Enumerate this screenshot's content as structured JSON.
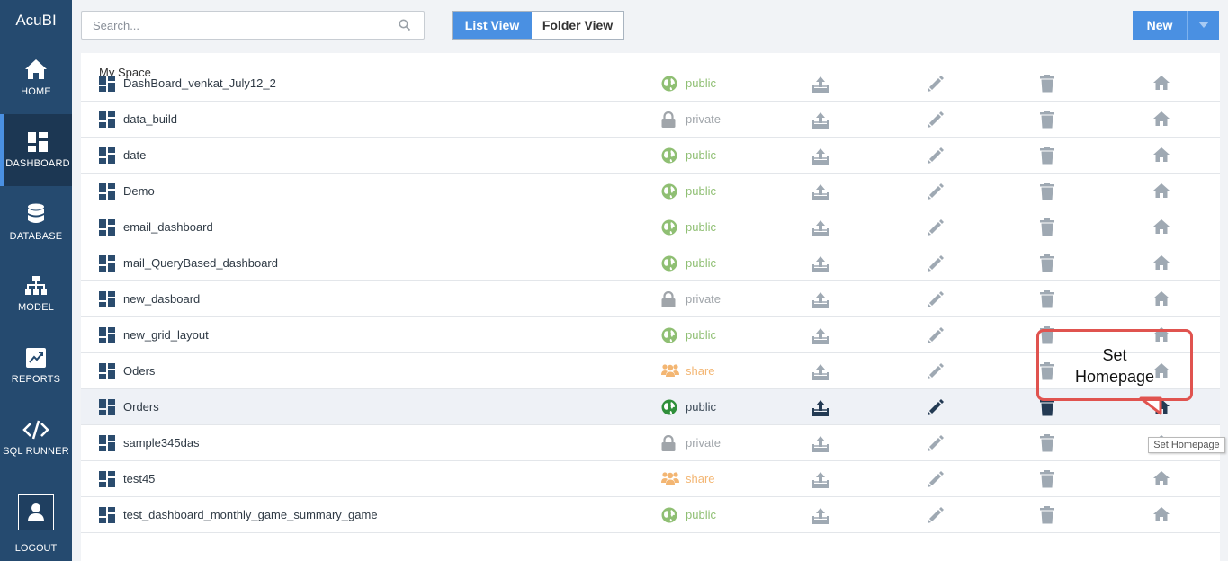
{
  "sidebar": {
    "brand": "AcuBI",
    "items": [
      {
        "label": "HOME",
        "icon": "home-icon"
      },
      {
        "label": "DASHBOARD",
        "icon": "dashboard-icon",
        "active": true
      },
      {
        "label": "DATABASE",
        "icon": "database-icon"
      },
      {
        "label": "MODEL",
        "icon": "model-icon"
      },
      {
        "label": "REPORTS",
        "icon": "reports-icon"
      },
      {
        "label": "SQL RUNNER",
        "icon": "code-icon"
      }
    ],
    "logout": "LOGOUT"
  },
  "toolbar": {
    "search_placeholder": "Search...",
    "list_view": "List View",
    "folder_view": "Folder View",
    "new_label": "New"
  },
  "main": {
    "section_title": "My Space",
    "rows": [
      {
        "name": "DashBoard_venkat_July12_2",
        "access": "public"
      },
      {
        "name": "data_build",
        "access": "private"
      },
      {
        "name": "date",
        "access": "public"
      },
      {
        "name": "Demo",
        "access": "public"
      },
      {
        "name": "email_dashboard",
        "access": "public"
      },
      {
        "name": "mail_QueryBased_dashboard",
        "access": "public"
      },
      {
        "name": "new_dasboard",
        "access": "private"
      },
      {
        "name": "new_grid_layout",
        "access": "public"
      },
      {
        "name": "Oders",
        "access": "share"
      },
      {
        "name": "Orders",
        "access": "public",
        "highlighted": true
      },
      {
        "name": "sample345das",
        "access": "private"
      },
      {
        "name": "test45",
        "access": "share"
      },
      {
        "name": "test_dashboard_monthly_game_summary_game",
        "access": "public"
      }
    ]
  },
  "annotation": {
    "line1": "Set",
    "line2": "Homepage"
  },
  "tooltip": "Set Homepage",
  "colors": {
    "sidebar": "#254a6f",
    "accent": "#4a90e2",
    "callout": "#e0534f",
    "public": "#8fbf73",
    "share": "#f3b673",
    "private": "#a0a5aa"
  }
}
